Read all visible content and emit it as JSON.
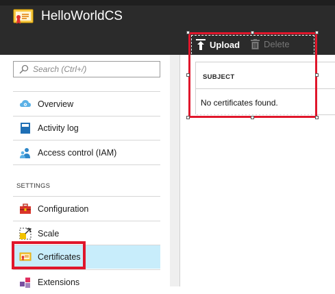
{
  "app": {
    "title": "HelloWorldCS"
  },
  "toolbar": {
    "upload_label": "Upload",
    "delete_label": "Delete"
  },
  "search": {
    "placeholder": "Search (Ctrl+/)"
  },
  "sidebar": {
    "items": [
      {
        "label": "Overview",
        "icon": "cloud-service-icon"
      },
      {
        "label": "Activity log",
        "icon": "activity-log-icon"
      },
      {
        "label": "Access control (IAM)",
        "icon": "users-icon"
      }
    ],
    "section_label": "SETTINGS",
    "settings_items": [
      {
        "label": "Configuration",
        "icon": "toolbox-icon"
      },
      {
        "label": "Scale",
        "icon": "scale-icon"
      },
      {
        "label": "Certificates",
        "icon": "certificate-icon",
        "active": true
      },
      {
        "label": "Extensions",
        "icon": "extensions-icon"
      }
    ]
  },
  "certificates_table": {
    "column_header": "SUBJECT",
    "empty_message": "No certificates found."
  },
  "colors": {
    "header_bg": "#2b2b2b",
    "active_item_bg": "#c8edfb",
    "highlight_red": "#e0162b"
  }
}
